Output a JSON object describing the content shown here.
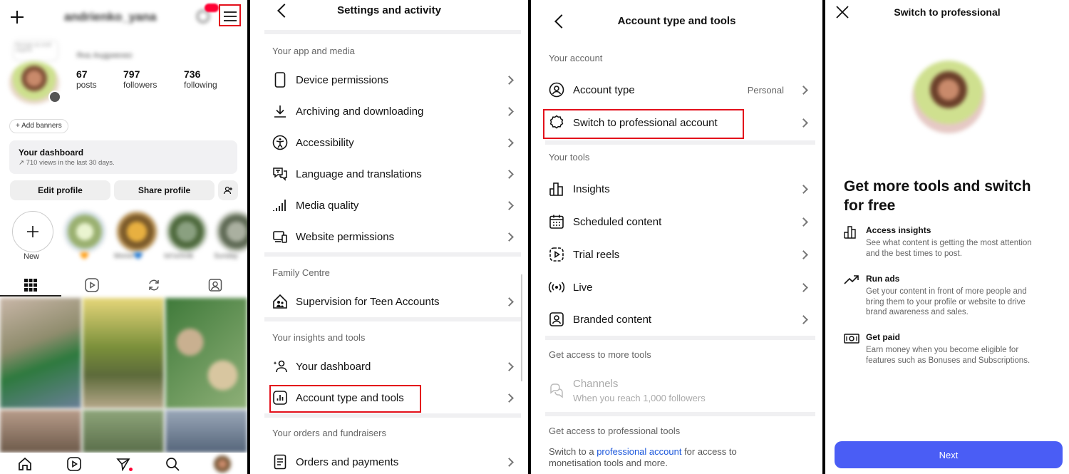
{
  "panel1": {
    "username": "andrienko_yana",
    "display_name": "Яна Андриенко",
    "note_text": "Беседа на этой неделе",
    "stats": [
      {
        "num": "67",
        "label": "posts"
      },
      {
        "num": "797",
        "label": "followers"
      },
      {
        "num": "736",
        "label": "following"
      }
    ],
    "add_banners": "+ Add banners",
    "dashboard_title": "Your dashboard",
    "dashboard_sub": "↗ 710 views in the last 30 days.",
    "edit_profile": "Edit profile",
    "share_profile": "Share profile",
    "new_label": "New",
    "highlights": [
      "🧡",
      "Monet💙",
      "Ist'ochnik",
      "Sunday"
    ]
  },
  "panel2": {
    "title": "Settings and activity",
    "sections": {
      "app_media": "Your app and media",
      "family": "Family Centre",
      "insights": "Your insights and tools",
      "orders": "Your orders and fundraisers"
    },
    "items": {
      "device_permissions": "Device permissions",
      "archiving": "Archiving and downloading",
      "accessibility": "Accessibility",
      "language": "Language and translations",
      "media_quality": "Media quality",
      "website_permissions": "Website permissions",
      "supervision": "Supervision for Teen Accounts",
      "your_dashboard": "Your dashboard",
      "account_type_tools": "Account type and tools",
      "orders_payments": "Orders and payments"
    }
  },
  "panel3": {
    "title": "Account type and tools",
    "sections": {
      "your_account": "Your account",
      "your_tools": "Your tools",
      "more_tools": "Get access to more tools",
      "pro_tools": "Get access to professional tools"
    },
    "items": {
      "account_type": "Account type",
      "account_type_value": "Personal",
      "switch_pro": "Switch to professional account",
      "insights": "Insights",
      "scheduled": "Scheduled content",
      "trial_reels": "Trial reels",
      "live": "Live",
      "branded": "Branded content",
      "channels": "Channels",
      "channels_sub": "When you reach 1,000 followers"
    },
    "pro_text_before": "Switch to a ",
    "pro_link": "professional account",
    "pro_text_after": " for access to",
    "pro_text_line2": "monetisation tools and more."
  },
  "panel4": {
    "title": "Switch to professional",
    "headline_line1": "Get more tools and switch",
    "headline_line2": "for free",
    "features": [
      {
        "title": "Access insights",
        "line1": "See what content is getting the most attention",
        "line2": "and the best times to post.",
        "line3": ""
      },
      {
        "title": "Run ads",
        "line1": "Get your content in front of more people and",
        "line2": "bring them to your profile or website to drive",
        "line3": "brand awareness and sales."
      },
      {
        "title": "Get paid",
        "line1": "Earn money when you become eligible for",
        "line2": "features such as Bonuses and Subscriptions.",
        "line3": ""
      }
    ],
    "next_button": "Next"
  },
  "colors": {
    "highlight_red": "#e3101b",
    "link_blue": "#1a56db",
    "next_button_blue": "#4a5df5"
  }
}
